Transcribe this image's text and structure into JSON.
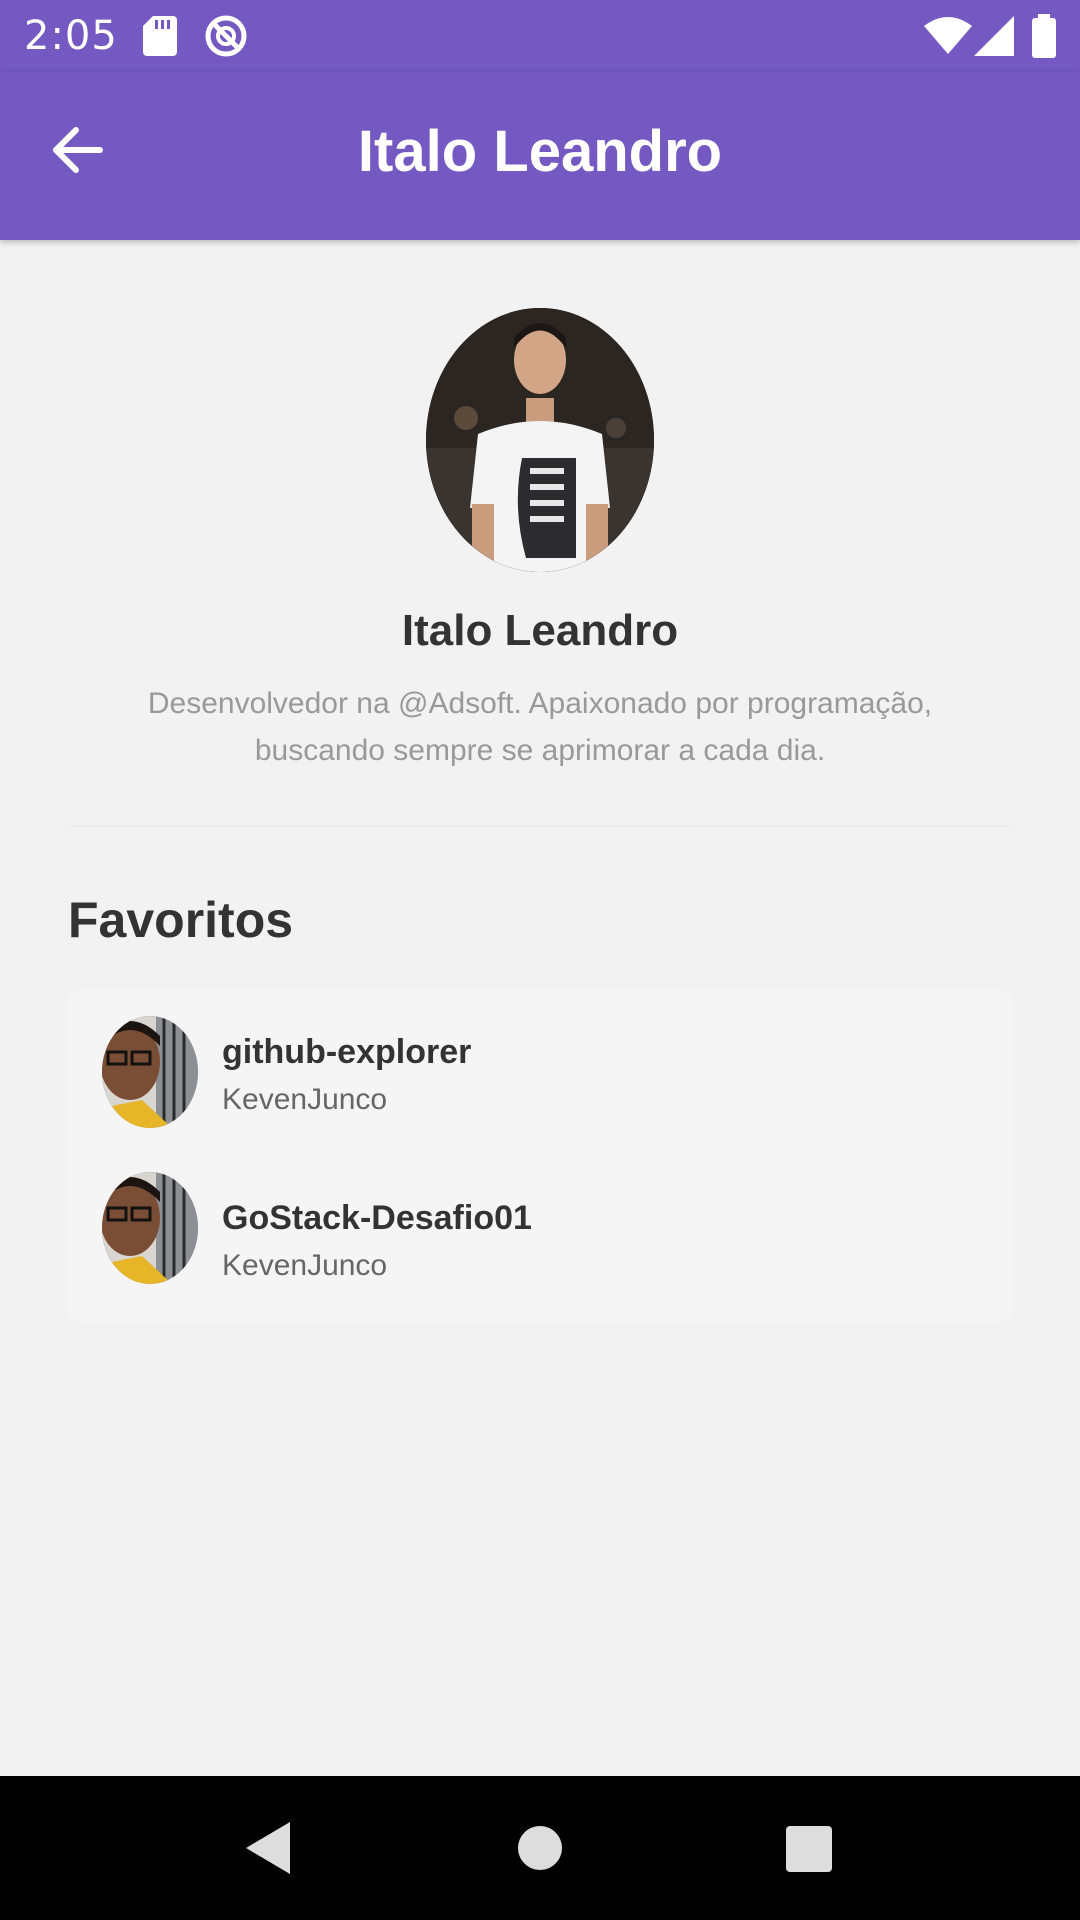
{
  "status_bar": {
    "time": "2:05",
    "icons": [
      "sd-card-icon",
      "sync-disabled-icon",
      "wifi-icon",
      "cell-signal-icon",
      "battery-icon"
    ]
  },
  "app_bar": {
    "title": "Italo Leandro",
    "back_icon": "arrow-left-icon",
    "color": "#7359c1"
  },
  "profile": {
    "name": "Italo Leandro",
    "bio": "Desenvolvedor na @Adsoft. Apaixonado por programação, buscando sempre se aprimorar a cada dia."
  },
  "favorites": {
    "title": "Favoritos",
    "items": [
      {
        "title": "github-explorer",
        "owner": "KevenJunco"
      },
      {
        "title": "GoStack-Desafio01",
        "owner": "KevenJunco"
      }
    ]
  },
  "nav_bar": {
    "icons": [
      "nav-back-icon",
      "nav-home-icon",
      "nav-recents-icon"
    ]
  }
}
